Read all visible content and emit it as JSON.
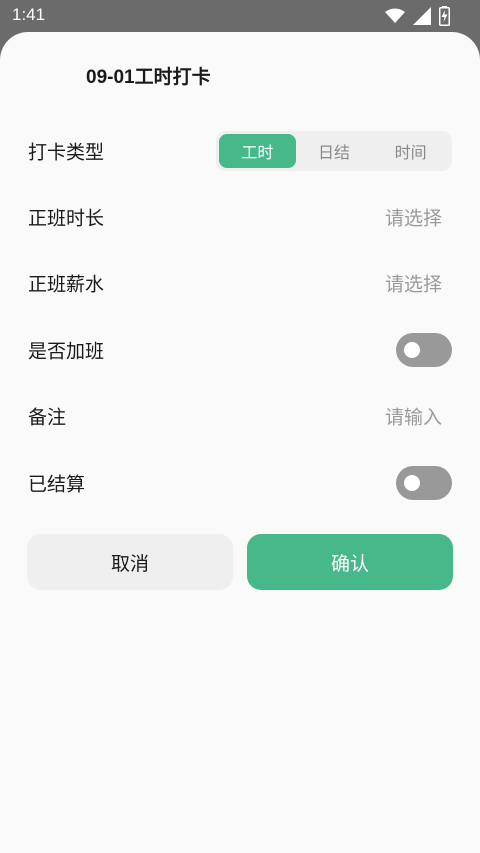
{
  "status_bar": {
    "time": "1:41",
    "icons": [
      "wifi-icon",
      "signal-icon",
      "battery-charging-icon"
    ]
  },
  "dialog": {
    "title": "09-01工时打卡",
    "punch_type": {
      "label": "打卡类型",
      "options": [
        "工时",
        "日结",
        "时间"
      ],
      "selected": "工时"
    },
    "regular_hours": {
      "label": "正班时长",
      "placeholder": "请选择"
    },
    "regular_pay": {
      "label": "正班薪水",
      "placeholder": "请选择"
    },
    "overtime": {
      "label": "是否加班",
      "on": false
    },
    "remark": {
      "label": "备注",
      "placeholder": "请输入"
    },
    "settled": {
      "label": "已结算",
      "on": false
    },
    "cancel_label": "取消",
    "confirm_label": "确认"
  },
  "colors": {
    "accent": "#46b88a",
    "toggle_off": "#999999",
    "placeholder": "#9a9a9a",
    "status_bar": "#6b6b6b"
  }
}
